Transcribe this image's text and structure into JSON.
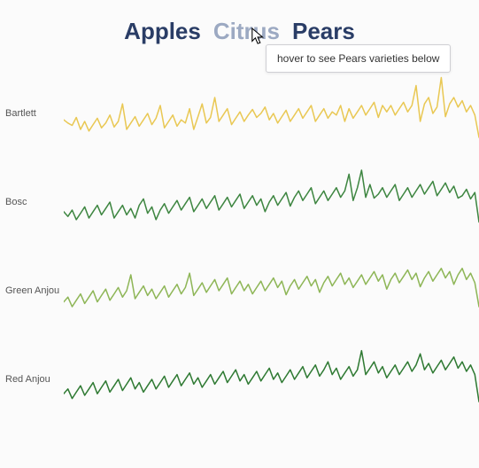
{
  "header": {
    "items": [
      "Apples",
      "Citrus",
      "Pears"
    ],
    "hovered_index": 2
  },
  "tooltip": {
    "text": "hover to see Pears varieties below"
  },
  "chart_data": {
    "type": "line",
    "title": "",
    "xlabel": "",
    "ylabel": "",
    "ylim": [
      0,
      100
    ],
    "x": [
      0,
      1,
      2,
      3,
      4,
      5,
      6,
      7,
      8,
      9,
      10,
      11,
      12,
      13,
      14,
      15,
      16,
      17,
      18,
      19,
      20,
      21,
      22,
      23,
      24,
      25,
      26,
      27,
      28,
      29,
      30,
      31,
      32,
      33,
      34,
      35,
      36,
      37,
      38,
      39,
      40,
      41,
      42,
      43,
      44,
      45,
      46,
      47,
      48,
      49,
      50,
      51,
      52,
      53,
      54,
      55,
      56,
      57,
      58,
      59,
      60,
      61,
      62,
      63,
      64,
      65,
      66,
      67,
      68,
      69,
      70,
      71,
      72,
      73,
      74,
      75,
      76,
      77,
      78,
      79,
      80,
      81,
      82,
      83,
      84,
      85,
      86,
      87,
      88,
      89,
      90,
      91,
      92,
      93,
      94,
      95,
      96,
      97,
      98,
      99
    ],
    "series": [
      {
        "name": "Bartlett",
        "color": "#e9c854",
        "values": [
          42,
          38,
          35,
          45,
          30,
          40,
          28,
          36,
          44,
          32,
          38,
          48,
          33,
          40,
          62,
          30,
          38,
          46,
          34,
          42,
          50,
          36,
          44,
          60,
          32,
          40,
          48,
          34,
          42,
          38,
          56,
          30,
          46,
          62,
          38,
          45,
          70,
          40,
          48,
          56,
          36,
          44,
          52,
          40,
          48,
          55,
          45,
          50,
          58,
          42,
          50,
          38,
          46,
          54,
          40,
          48,
          56,
          44,
          52,
          60,
          40,
          48,
          56,
          44,
          52,
          48,
          60,
          40,
          56,
          44,
          52,
          60,
          48,
          56,
          64,
          45,
          60,
          52,
          60,
          48,
          56,
          64,
          52,
          60,
          85,
          40,
          62,
          70,
          50,
          58,
          95,
          46,
          62,
          70,
          58,
          66,
          52,
          60,
          48,
          20
        ]
      },
      {
        "name": "Bosc",
        "color": "#3e8641",
        "values": [
          38,
          32,
          40,
          28,
          36,
          44,
          30,
          38,
          46,
          34,
          42,
          50,
          30,
          38,
          46,
          34,
          42,
          30,
          46,
          54,
          36,
          44,
          28,
          40,
          48,
          36,
          44,
          52,
          40,
          48,
          56,
          38,
          46,
          54,
          42,
          50,
          58,
          40,
          48,
          56,
          44,
          52,
          60,
          42,
          50,
          58,
          46,
          54,
          38,
          50,
          58,
          46,
          54,
          62,
          45,
          56,
          64,
          52,
          60,
          68,
          48,
          56,
          64,
          52,
          60,
          68,
          56,
          64,
          85,
          52,
          68,
          90,
          56,
          72,
          55,
          60,
          68,
          56,
          64,
          72,
          52,
          60,
          68,
          56,
          64,
          72,
          60,
          68,
          76,
          58,
          66,
          74,
          62,
          70,
          55,
          58,
          66,
          54,
          62,
          25
        ]
      },
      {
        "name": "Green Anjou",
        "color": "#8eb657",
        "values": [
          36,
          42,
          30,
          38,
          46,
          34,
          42,
          50,
          36,
          44,
          52,
          38,
          46,
          54,
          42,
          50,
          70,
          40,
          48,
          56,
          44,
          52,
          40,
          48,
          56,
          42,
          50,
          58,
          46,
          54,
          72,
          44,
          52,
          60,
          48,
          56,
          64,
          50,
          58,
          66,
          46,
          54,
          62,
          50,
          58,
          46,
          54,
          62,
          50,
          58,
          66,
          54,
          62,
          45,
          56,
          64,
          52,
          60,
          68,
          56,
          64,
          48,
          60,
          68,
          56,
          64,
          72,
          58,
          66,
          54,
          62,
          70,
          58,
          66,
          74,
          62,
          70,
          52,
          64,
          72,
          60,
          68,
          76,
          64,
          72,
          55,
          66,
          74,
          62,
          70,
          78,
          66,
          74,
          58,
          70,
          78,
          64,
          72,
          60,
          30
        ]
      },
      {
        "name": "Red Anjou",
        "color": "#2f7a33",
        "values": [
          32,
          38,
          26,
          34,
          42,
          30,
          38,
          46,
          32,
          40,
          48,
          34,
          42,
          50,
          36,
          44,
          52,
          38,
          46,
          34,
          42,
          50,
          38,
          46,
          54,
          40,
          48,
          56,
          42,
          50,
          58,
          44,
          52,
          40,
          48,
          56,
          44,
          52,
          60,
          46,
          54,
          62,
          48,
          56,
          44,
          52,
          60,
          48,
          56,
          64,
          50,
          58,
          46,
          54,
          62,
          50,
          58,
          66,
          52,
          60,
          68,
          54,
          62,
          72,
          56,
          64,
          50,
          58,
          66,
          54,
          62,
          86,
          56,
          64,
          72,
          58,
          66,
          52,
          60,
          68,
          56,
          64,
          72,
          60,
          68,
          82,
          62,
          70,
          58,
          66,
          74,
          62,
          70,
          78,
          64,
          72,
          60,
          68,
          56,
          22
        ]
      }
    ]
  }
}
